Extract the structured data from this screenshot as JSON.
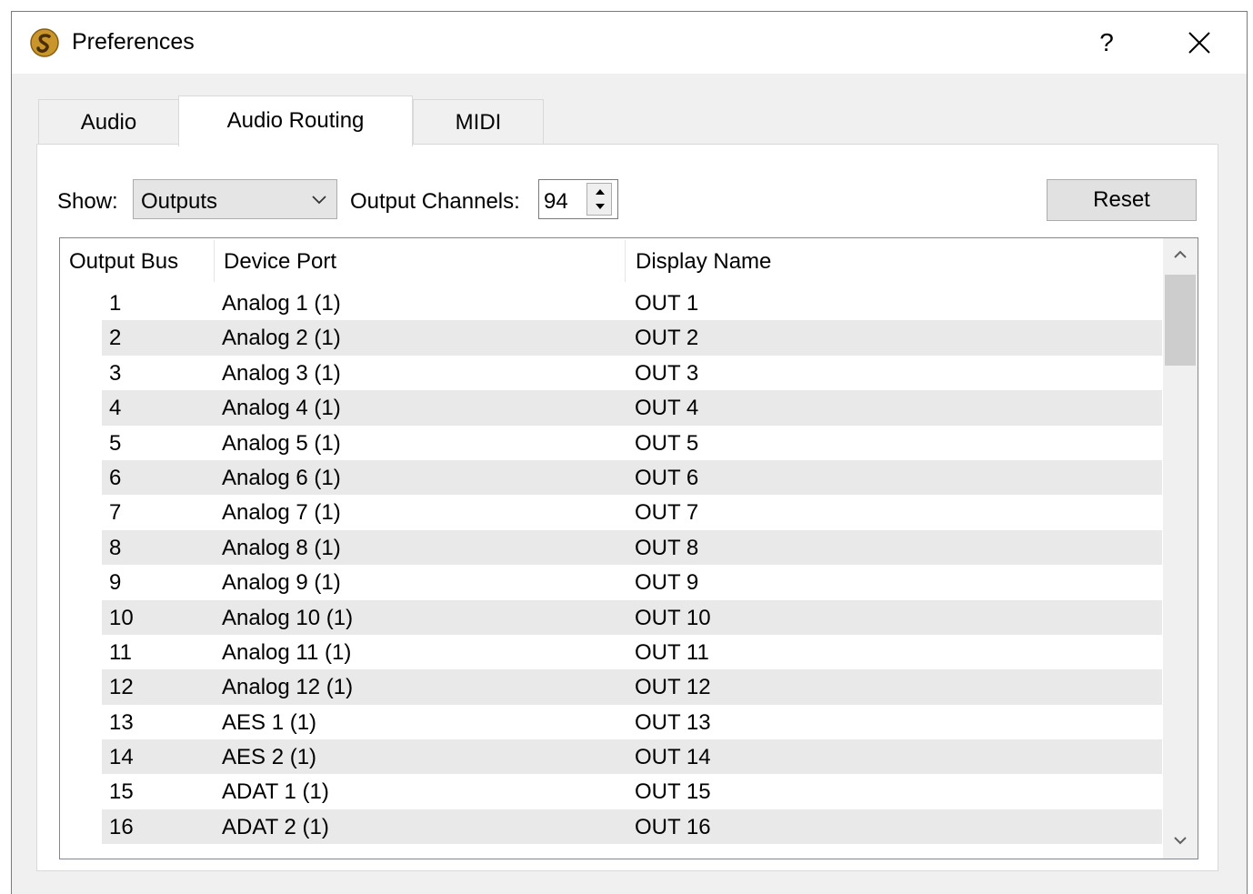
{
  "window": {
    "title": "Preferences",
    "help_label": "?"
  },
  "tabs": [
    {
      "label": "Audio",
      "active": false
    },
    {
      "label": "Audio Routing",
      "active": true
    },
    {
      "label": "MIDI",
      "active": false
    }
  ],
  "toolbar": {
    "show_label": "Show:",
    "show_value": "Outputs",
    "channels_label": "Output Channels:",
    "channels_value": "94",
    "reset_label": "Reset"
  },
  "table": {
    "columns": [
      "Output Bus",
      "Device Port",
      "Display Name"
    ],
    "rows": [
      {
        "bus": "1",
        "port": "Analog 1 (1)",
        "name": "OUT 1"
      },
      {
        "bus": "2",
        "port": "Analog 2 (1)",
        "name": "OUT 2"
      },
      {
        "bus": "3",
        "port": "Analog 3 (1)",
        "name": "OUT 3"
      },
      {
        "bus": "4",
        "port": "Analog 4 (1)",
        "name": "OUT 4"
      },
      {
        "bus": "5",
        "port": "Analog 5 (1)",
        "name": "OUT 5"
      },
      {
        "bus": "6",
        "port": "Analog 6 (1)",
        "name": "OUT 6"
      },
      {
        "bus": "7",
        "port": "Analog 7 (1)",
        "name": "OUT 7"
      },
      {
        "bus": "8",
        "port": "Analog 8 (1)",
        "name": "OUT 8"
      },
      {
        "bus": "9",
        "port": "Analog 9 (1)",
        "name": "OUT 9"
      },
      {
        "bus": "10",
        "port": "Analog 10 (1)",
        "name": "OUT 10"
      },
      {
        "bus": "11",
        "port": "Analog 11 (1)",
        "name": "OUT 11"
      },
      {
        "bus": "12",
        "port": "Analog 12 (1)",
        "name": "OUT 12"
      },
      {
        "bus": "13",
        "port": "AES 1 (1)",
        "name": "OUT 13"
      },
      {
        "bus": "14",
        "port": "AES 2 (1)",
        "name": "OUT 14"
      },
      {
        "bus": "15",
        "port": "ADAT 1 (1)",
        "name": "OUT 15"
      },
      {
        "bus": "16",
        "port": "ADAT 2 (1)",
        "name": "OUT 16"
      }
    ]
  },
  "icons": {
    "app": "app-logo-icon",
    "close": "close-icon",
    "dropdown": "chevron-down-icon",
    "spin_up": "spin-up-icon",
    "spin_down": "spin-down-icon",
    "scroll_up": "scroll-up-icon",
    "scroll_down": "scroll-down-icon"
  },
  "colors": {
    "window_bg": "#f0f0f0",
    "row_stripe": "#e9e9e9",
    "logo_gold": "#c8962a"
  }
}
